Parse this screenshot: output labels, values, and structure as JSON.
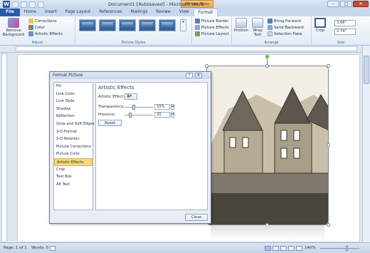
{
  "titlebar": {
    "title": "Document1 [Autosaved] - Microsoft Word",
    "context_tab": "Picture Tools",
    "app_icon": "W"
  },
  "tabs": [
    {
      "label": "File"
    },
    {
      "label": "Home"
    },
    {
      "label": "Insert"
    },
    {
      "label": "Page Layout"
    },
    {
      "label": "References"
    },
    {
      "label": "Mailings"
    },
    {
      "label": "Review"
    },
    {
      "label": "View"
    },
    {
      "label": "Format"
    }
  ],
  "ribbon": {
    "adjust": {
      "remove_background": "Remove Background",
      "corrections": "Corrections",
      "color": "Color",
      "artistic_effects": "Artistic Effects",
      "label": "Adjust"
    },
    "picture_styles": {
      "label": "Picture Styles"
    },
    "picture_options": {
      "border": "Picture Border",
      "effects": "Picture Effects",
      "layout": "Picture Layout"
    },
    "arrange": {
      "position": "Position",
      "wrap_text": "Wrap Text",
      "bring_forward": "Bring Forward",
      "send_backward": "Send Backward",
      "selection_pane": "Selection Pane",
      "label": "Arrange"
    },
    "size": {
      "crop": "Crop",
      "height": "3.66\"",
      "width": "2.74\"",
      "label": "Size"
    }
  },
  "dialog": {
    "title": "Format Picture",
    "help": "?",
    "close_x": "X",
    "categories": [
      "Fill",
      "Line Color",
      "Line Style",
      "Shadow",
      "Reflection",
      "Glow and Soft Edges",
      "3-D Format",
      "3-D Rotation",
      "Picture Corrections",
      "Picture Color",
      "Artistic Effects",
      "Crop",
      "Text Box",
      "Alt Text"
    ],
    "selected_category": "Artistic Effects",
    "panel_title": "Artistic Effects",
    "artistic_effect_label": "Artistic Effect:",
    "transparency_label": "Transparency:",
    "transparency_value": "33%",
    "transparency_fraction": 0.33,
    "pressure_label": "Pressure:",
    "pressure_value": "20",
    "pressure_fraction": 0.2,
    "reset": "Reset",
    "close": "Close"
  },
  "statusbar": {
    "page": "Page: 1 of 1",
    "words": "Words: 0",
    "zoom": "140%"
  },
  "colors": {
    "accent": "#2a5aa6",
    "context": "#e7a94e",
    "selected_category": "#f6d77a"
  }
}
